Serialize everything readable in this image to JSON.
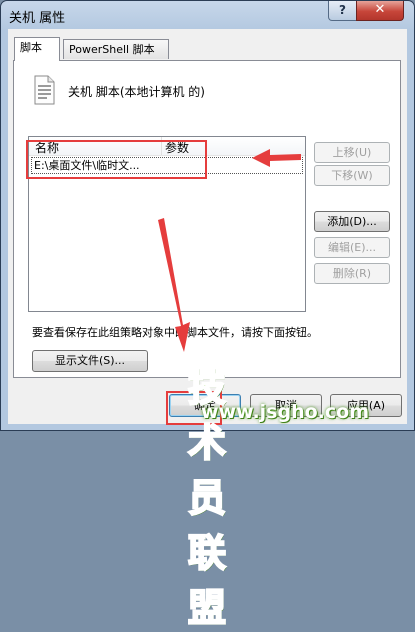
{
  "window": {
    "title": "关机 属性",
    "help_glyph": "?",
    "close_glyph": "✕"
  },
  "tabs": [
    {
      "label": "脚本",
      "active": true
    },
    {
      "label": "PowerShell 脚本",
      "active": false
    }
  ],
  "panel": {
    "icon": "script-document-icon",
    "header": "关机 脚本(本地计算机 的)",
    "list": {
      "columns": [
        "名称",
        "参数"
      ],
      "rows": [
        {
          "name": "E:\\桌面文件\\临时文...",
          "params": ""
        }
      ]
    },
    "buttons": {
      "move_up": "上移(U)",
      "move_down": "下移(W)",
      "add": "添加(D)...",
      "edit": "编辑(E)...",
      "remove": "删除(R)"
    },
    "info": "要查看保存在此组策略对象中的脚本文件，请按下面按钮。",
    "show_files": "显示文件(S)..."
  },
  "footer": {
    "ok": "确定",
    "cancel": "取消",
    "apply": "应用(A)"
  },
  "annotations": {
    "color": "#e53d3d"
  },
  "watermark": {
    "main": "技术员联盟",
    "url": "www.jsgho.com",
    "color": "#7cc63a"
  }
}
